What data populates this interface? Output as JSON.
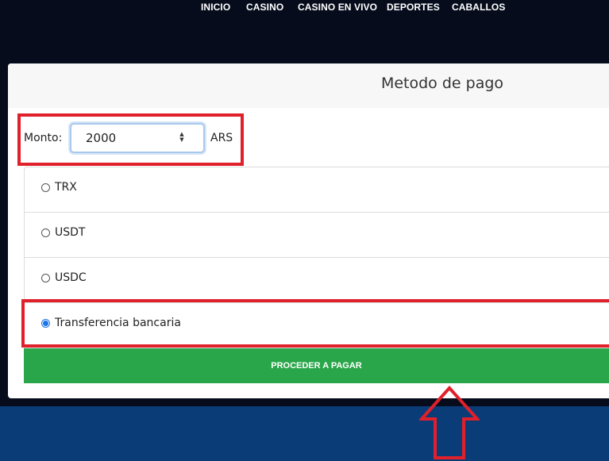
{
  "nav": {
    "items": [
      {
        "label": "INICIO"
      },
      {
        "label": "CASINO"
      },
      {
        "label": "CASINO EN VIVO"
      },
      {
        "label": "DEPORTES"
      },
      {
        "label": "CABALLOS"
      }
    ]
  },
  "modal": {
    "title": "Metodo de pago",
    "amount": {
      "label": "Monto:",
      "value": "2000",
      "currency": "ARS"
    },
    "options": [
      {
        "label": "TRX",
        "selected": false
      },
      {
        "label": "USDT",
        "selected": false
      },
      {
        "label": "USDC",
        "selected": false
      },
      {
        "label": "Transferencia bancaria",
        "selected": true
      }
    ],
    "submit_label": "PROCEDER A PAGAR"
  },
  "colors": {
    "header_bg": "#060c1c",
    "bottom_band": "#0a3c78",
    "button_green": "#2aa64a",
    "annotation_red": "#e0202b"
  }
}
